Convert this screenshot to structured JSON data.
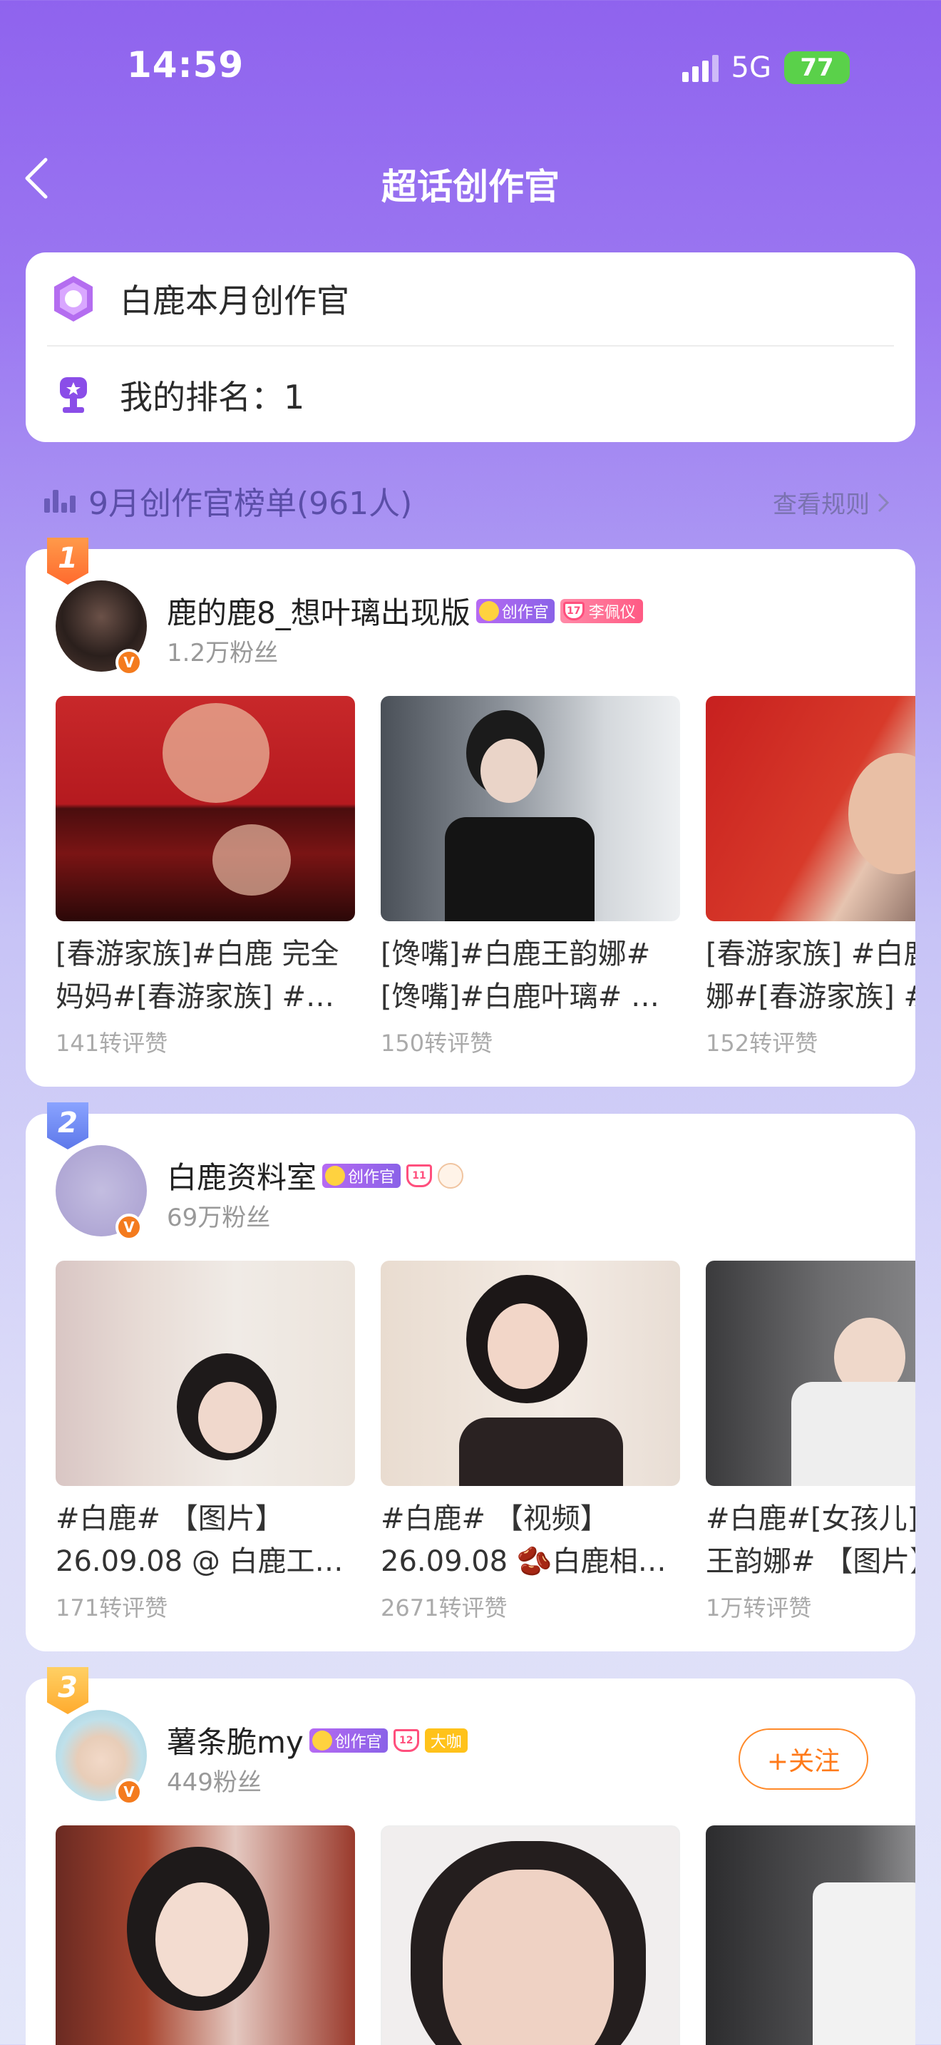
{
  "status_bar": {
    "time": "14:59",
    "network": "5G",
    "battery": "77"
  },
  "header": {
    "title": "超话创作官"
  },
  "info_card": {
    "monthly_label": "白鹿本月创作官",
    "my_rank_label": "我的排名：1"
  },
  "list_header": {
    "title": "9月创作官榜单(961人)",
    "rules_link": "查看规则"
  },
  "creators": [
    {
      "rank": "1",
      "name": "鹿的鹿8_想叶璃出现版",
      "creator_tag": "创作官",
      "diamond_level": "17",
      "extra_tag": "李佩仪",
      "fans": "1.2万粉丝",
      "posts": [
        {
          "title": "[春游家族]#白鹿 完全\n妈妈#[春游家族] #…",
          "stats": "141转评赞"
        },
        {
          "title": "[馋嘴]#白鹿王韵娜#\n[馋嘴]#白鹿叶璃# …",
          "stats": "150转评赞"
        },
        {
          "title": "[春游家族] #白鹿\n娜#[春游家族] #",
          "stats": "152转评赞"
        }
      ]
    },
    {
      "rank": "2",
      "name": "白鹿资料室",
      "creator_tag": "创作官",
      "diamond_level": "11",
      "fans": "69万粉丝",
      "posts": [
        {
          "title": "#白鹿# 【图片】\n26.09.08 @ 白鹿工…",
          "stats": "171转评赞"
        },
        {
          "title": "#白鹿# 【视频】\n26.09.08 🫘白鹿相…",
          "stats": "2671转评赞"
        },
        {
          "title": "#白鹿#[女孩儿]#\n王韵娜# 【图片】",
          "stats": "1万转评赞"
        }
      ]
    },
    {
      "rank": "3",
      "name": "薯条脆my",
      "creator_tag": "创作官",
      "diamond_level": "12",
      "extra_tag": "大咖",
      "fans": "449粉丝",
      "follow_label": "+关注",
      "posts": []
    }
  ],
  "colors": {
    "accent_purple": "#8f63ee",
    "follow_orange": "#ff7a1a",
    "rank1": "#ff7a3d",
    "rank2": "#6d8af0",
    "rank3": "#ffb53a"
  }
}
